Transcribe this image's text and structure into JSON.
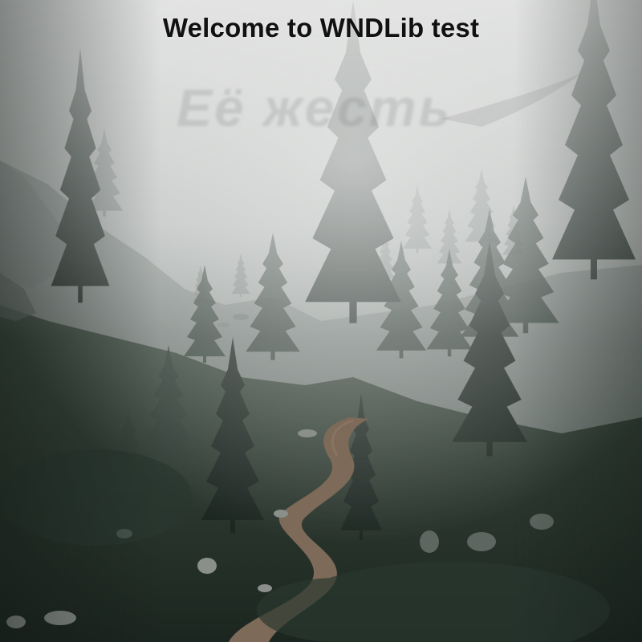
{
  "window": {
    "title": "Welcome to WNDLib test"
  },
  "watermark": {
    "text": "Её жесть"
  },
  "background": {
    "image": "misty-pine-forest-trail",
    "colors": {
      "fog": "#c9cccb",
      "forest_dark": "#1f2b25",
      "forest_mid": "#2f3d35",
      "grass": "#3a4a3c",
      "trail": "#7d6a58"
    }
  }
}
